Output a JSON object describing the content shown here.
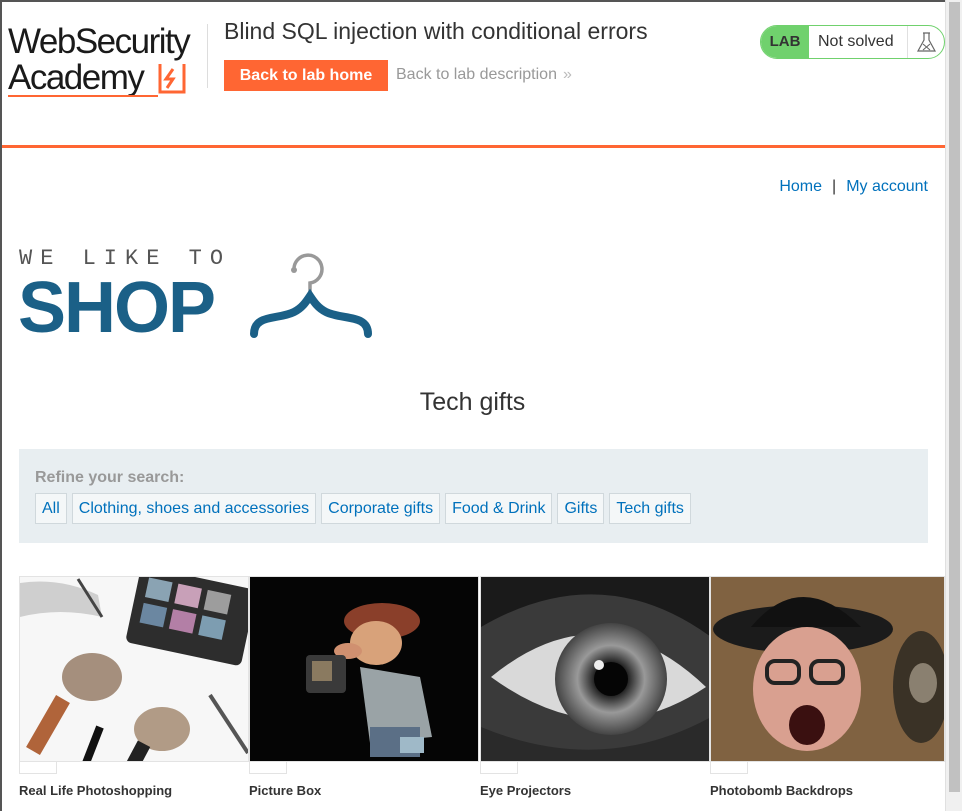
{
  "academy": {
    "logo_line1": "WebSecurity",
    "logo_line2": "Academy",
    "lab_title": "Blind SQL injection with conditional errors",
    "back_home_label": "Back to lab home",
    "back_description_label": "Back to lab description",
    "back_description_icon": "double-chevron-right-icon",
    "status": {
      "tag": "LAB",
      "text": "Not solved",
      "icon": "flask-icon",
      "color": "#70d16d"
    },
    "accent_color": "#ff6633"
  },
  "nav": {
    "home_label": "Home",
    "separator": "|",
    "account_label": "My account"
  },
  "shop_logo": {
    "tagline": "WE LIKE TO",
    "word": "SHOP",
    "icon": "hanger-icon",
    "color": "#1b6087"
  },
  "category_heading": "Tech gifts",
  "filters": {
    "label": "Refine your search:",
    "items": [
      {
        "label": "All"
      },
      {
        "label": "Clothing, shoes and accessories"
      },
      {
        "label": "Corporate gifts"
      },
      {
        "label": "Food & Drink"
      },
      {
        "label": "Gifts"
      },
      {
        "label": "Tech gifts"
      }
    ]
  },
  "products": [
    {
      "name": "Real Life Photoshopping",
      "image": "makeup-brushes-image"
    },
    {
      "name": "Picture Box",
      "image": "photographer-figure-image"
    },
    {
      "name": "Eye Projectors",
      "image": "eye-closeup-image"
    },
    {
      "name": "Photobomb Backdrops",
      "image": "shouting-man-image"
    }
  ]
}
